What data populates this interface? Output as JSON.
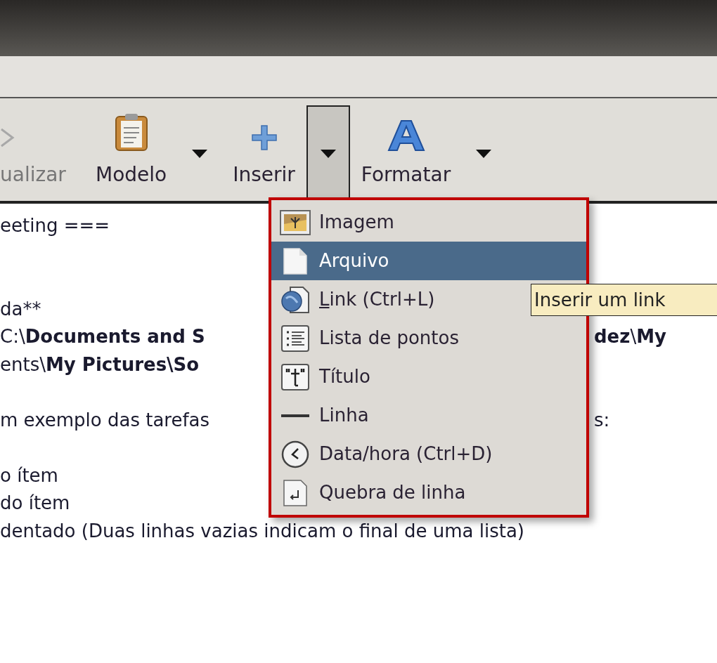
{
  "toolbar": {
    "items": [
      {
        "label": "ualizar"
      },
      {
        "label": "Modelo",
        "dropdown": {
          "pressed": false
        }
      },
      {
        "label": "Inserir",
        "dropdown": {
          "pressed": true
        }
      },
      {
        "label": "Formatar",
        "dropdown": {
          "pressed": false
        }
      }
    ]
  },
  "editor": {
    "lines": [
      {
        "kind": "text",
        "left": "eeting ==="
      },
      {
        "kind": "blank"
      },
      {
        "kind": "blank"
      },
      {
        "kind": "text",
        "left": "da**"
      },
      {
        "kind": "text",
        "left": "C:\\**Documents and S**",
        "right": "**dez**\\**My**"
      },
      {
        "kind": "text",
        "left": "ents\\**My Pictures\\So**"
      },
      {
        "kind": "blank"
      },
      {
        "kind": "text",
        "left": "m exemplo das tarefas",
        "right": "s:"
      },
      {
        "kind": "blank"
      },
      {
        "kind": "text",
        "left": "o ítem"
      },
      {
        "kind": "text",
        "left": "do ítem"
      },
      {
        "kind": "text",
        "left": "dentado (Duas linhas vazias indicam o final de uma lista)"
      }
    ]
  },
  "menu": {
    "items": [
      {
        "kind": "image",
        "label": "Imagem",
        "selected": false,
        "underline_first": false
      },
      {
        "kind": "file",
        "label": "Arquivo",
        "selected": true,
        "underline_first": false
      },
      {
        "kind": "link",
        "label": "Link (Ctrl+L)",
        "selected": false,
        "underline_first": true
      },
      {
        "kind": "list",
        "label": "Lista de pontos",
        "selected": false,
        "underline_first": false
      },
      {
        "kind": "title",
        "label": "Título",
        "selected": false,
        "underline_first": false
      },
      {
        "kind": "line",
        "label": "Linha",
        "selected": false,
        "underline_first": false
      },
      {
        "kind": "datetime",
        "label": "Data/hora (Ctrl+D)",
        "selected": false,
        "underline_first": false
      },
      {
        "kind": "break",
        "label": "Quebra de linha",
        "selected": false,
        "underline_first": false
      }
    ]
  },
  "tooltip": {
    "text": "Inserir um link"
  }
}
